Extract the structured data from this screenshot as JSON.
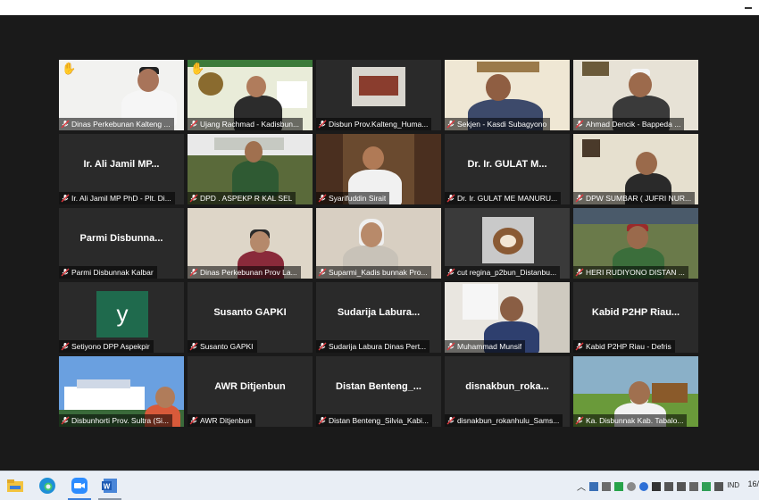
{
  "taskbar": {
    "lang": "IND",
    "clock": "16/"
  },
  "tiles": [
    {
      "name": "Dinas Perkebunan Kalteng ...",
      "center": "",
      "hand": true
    },
    {
      "name": "Ujang Rachmad - Kadisbun...",
      "center": "",
      "hand": true
    },
    {
      "name": "Disbun Prov.Kalteng_Huma...",
      "center": "",
      "hand": false
    },
    {
      "name": "Sekjen - Kasdi Subagyono",
      "center": "",
      "hand": false
    },
    {
      "name": "Ahmad Dencik - Bappeda ...",
      "center": "",
      "hand": false
    },
    {
      "name": "Ir. Ali Jamil MP PhD - Plt. Di...",
      "center": "Ir. Ali Jamil MP...",
      "hand": false
    },
    {
      "name": "DPD . ASPEKP R KAL SEL",
      "center": "",
      "hand": false
    },
    {
      "name": "Syarifuddin Sirait",
      "center": "",
      "hand": false
    },
    {
      "name": "Dr. Ir. GULAT ME MANURU...",
      "center": "Dr. Ir. GULAT M...",
      "hand": false
    },
    {
      "name": "DPW SUMBAR ( JUFRI NUR...",
      "center": "",
      "hand": false
    },
    {
      "name": "Parmi Disbunnak Kalbar",
      "center": "Parmi Disbunna...",
      "hand": false
    },
    {
      "name": "Dinas Perkebunan Prov La...",
      "center": "",
      "hand": false
    },
    {
      "name": "Suparmi_Kadis bunnak Pro...",
      "center": "",
      "hand": false
    },
    {
      "name": "cut regina_p2bun_Distanbu...",
      "center": "",
      "hand": false
    },
    {
      "name": "HERI RUDIYONO DISTAN ...",
      "center": "",
      "hand": false
    },
    {
      "name": "Setiyono DPP Aspekpir",
      "center": "",
      "hand": false,
      "avatar": "y"
    },
    {
      "name": "Susanto GAPKI",
      "center": "Susanto GAPKI",
      "hand": false
    },
    {
      "name": "Sudarija Labura Dinas Pert...",
      "center": "Sudarija Labura...",
      "hand": false
    },
    {
      "name": "Muhammad Munsif",
      "center": "",
      "hand": false,
      "active": true
    },
    {
      "name": "Kabid P2HP Riau - Defris",
      "center": "Kabid P2HP Riau...",
      "hand": false
    },
    {
      "name": "Disbunhorti Prov. Sultra (Si...",
      "center": "",
      "hand": false
    },
    {
      "name": "AWR Ditjenbun",
      "center": "AWR Ditjenbun",
      "hand": false
    },
    {
      "name": "Distan Benteng_Silvia_Kabi...",
      "center": "Distan Benteng_...",
      "hand": false
    },
    {
      "name": "disnakbun_rokanhulu_Sams...",
      "center": "disnakbun_roka...",
      "hand": false
    },
    {
      "name": "Ka. Disbunnak Kab. Tabalo...",
      "center": "",
      "hand": false
    }
  ]
}
